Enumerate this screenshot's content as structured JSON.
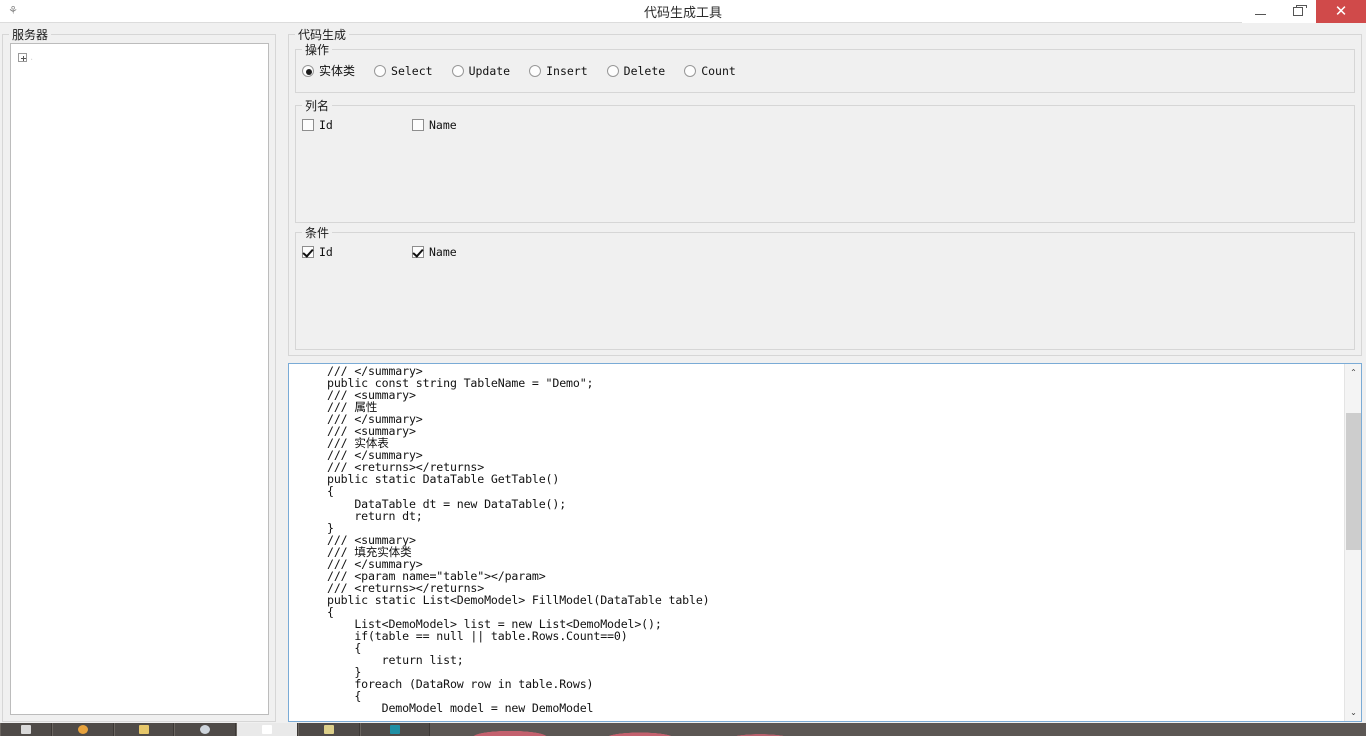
{
  "window": {
    "title": "代码生成工具",
    "icon": "app-icon",
    "controls": {
      "minimize": "minimize-icon",
      "maximize": "restore-icon",
      "close": "✕"
    },
    "accent_close": "#d04a4a"
  },
  "server_panel": {
    "group_title": "服务器",
    "tree": {
      "expander": "+",
      "root_label": "."
    }
  },
  "codegen_panel": {
    "group_title": "代码生成",
    "operation": {
      "group_title": "操作",
      "selected": "实体类",
      "options": [
        {
          "label": "实体类",
          "checked": true,
          "cjk": true
        },
        {
          "label": "Select",
          "checked": false,
          "cjk": false
        },
        {
          "label": "Update",
          "checked": false,
          "cjk": false
        },
        {
          "label": "Insert",
          "checked": false,
          "cjk": false
        },
        {
          "label": "Delete",
          "checked": false,
          "cjk": false
        },
        {
          "label": "Count",
          "checked": false,
          "cjk": false
        }
      ]
    },
    "columns": {
      "group_title": "列名",
      "items": [
        {
          "label": "Id",
          "checked": false
        },
        {
          "label": "Name",
          "checked": false
        }
      ]
    },
    "conditions": {
      "group_title": "条件",
      "items": [
        {
          "label": "Id",
          "checked": true
        },
        {
          "label": "Name",
          "checked": true
        }
      ]
    }
  },
  "code_output": {
    "text": "/// </summary>\npublic const string TableName = \"Demo\";\n/// <summary>\n/// 属性\n/// </summary>\n/// <summary>\n/// 实体表\n/// </summary>\n/// <returns></returns>\npublic static DataTable GetTable()\n{\n    DataTable dt = new DataTable();\n    return dt;\n}\n/// <summary>\n/// 填充实体类\n/// </summary>\n/// <param name=\"table\"></param>\n/// <returns></returns>\npublic static List<DemoModel> FillModel(DataTable table)\n{\n    List<DemoModel> list = new List<DemoModel>();\n    if(table == null || table.Rows.Count==0)\n    {\n        return list;\n    }\n    foreach (DataRow row in table.Rows)\n    {\n        DemoModel model = new DemoModel",
    "scrollbar": {
      "up_arrow": "⌃",
      "down_arrow": "⌄"
    }
  }
}
